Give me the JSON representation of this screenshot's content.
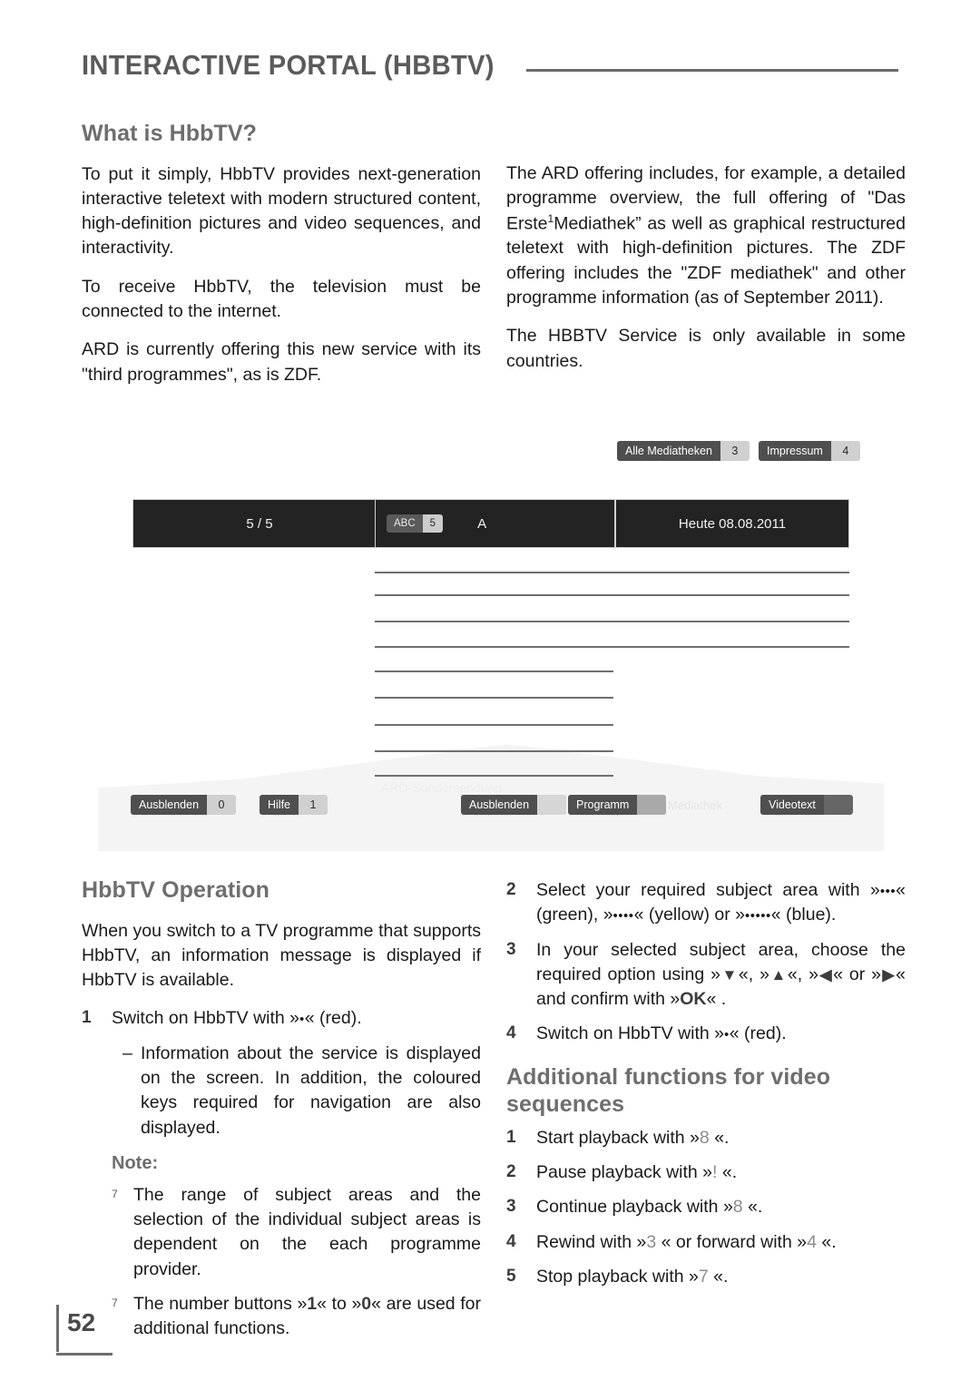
{
  "chapter": {
    "title": "INTERACTIVE PORTAL (HBBTV)"
  },
  "sections": {
    "what_is": {
      "heading": "What is HbbTV?",
      "left_paragraphs": [
        "To put it simply, HbbTV provides next-generation interactive teletext with modern structured content, high-definition pictures and video sequences, and interactivity.",
        "To receive HbbTV, the television must be connected to the internet.",
        "ARD is currently offering this new service with its \"third programmes\", as is ZDF."
      ],
      "right_para_1_a": "The ARD offering includes, for example, a detailed programme overview, the full offering of \"Das Erste",
      "right_para_1_fn": "1",
      "right_para_1_b": "Mediathek” as well as graphical restructured teletext with high-definition pictures. The ZDF offering includes the \"ZDF mediathek\" and other programme information (as of September 2011).",
      "right_para_2": "The HBBTV Service is only available in some countries."
    },
    "operation": {
      "heading": "HbbTV Operation",
      "intro": "When you switch to a TV programme that supports HbbTV, an information message is displayed if HbbTV is available.",
      "step1_num": "1",
      "step1_a": "Switch on HbbTV with »",
      "step1_key": "•",
      "step1_b": "« (red).",
      "substep1_dash": "–",
      "substep1_text": "Information about the service is displayed on the screen. In addition, the coloured keys required for navigation are also displayed.",
      "note_label": "Note:",
      "note_bullets": [
        {
          "mark": "7",
          "text": "The range of subject areas and the selection of the individual subject areas is dependent on the each programme provider."
        }
      ],
      "note_bullet2": {
        "mark": "7",
        "a": "The number buttons »",
        "key1": "1",
        "b": "« to »",
        "key2": "0",
        "c": "« are used for additional functions."
      },
      "step2_num": "2",
      "step2_a": "Select your required subject area with »",
      "step2_key1": "•••",
      "step2_b": "« (green), »",
      "step2_key2": "••••",
      "step2_c": "« (yellow) or »",
      "step2_key3": "•••••",
      "step2_d": "« (blue).",
      "step3_num": "3",
      "step3_a": "In your selected subject area, choose the required option using »",
      "step3_k1": "▼",
      "step3_b": "«, »",
      "step3_k2": "▲",
      "step3_c": "«, »",
      "step3_k3": "◀",
      "step3_d": "« or »",
      "step3_k4": "▶",
      "step3_e": "« and confirm with »",
      "step3_k5": "OK",
      "step3_f": "« .",
      "step4_num": "4",
      "step4_a": "Switch on HbbTV with »",
      "step4_key": "•",
      "step4_b": "« (red)."
    },
    "additional": {
      "heading": "Additional functions for video sequences",
      "steps": [
        {
          "num": "1",
          "a": "Start playback with »",
          "key": "8",
          "b": "  «."
        },
        {
          "num": "2",
          "a": "Pause playback with »",
          "key": "!",
          "b": "  «."
        },
        {
          "num": "3",
          "a": "Continue playback with »",
          "key": "8",
          "b": "  «."
        },
        {
          "num": "4",
          "a": "Rewind with »",
          "key": "3",
          "b": "  « or forward with »",
          "key2": "4",
          "c": "  «."
        },
        {
          "num": "5",
          "a": "Stop playback with »",
          "key": "7",
          "b": " «."
        }
      ]
    }
  },
  "illustration": {
    "top_buttons": [
      {
        "label": "Alle Mediatheken",
        "value": "3"
      },
      {
        "label": "Impressum",
        "value": "4"
      }
    ],
    "bars": {
      "left_text": "5 / 5",
      "mid_pill_label": "ABC",
      "mid_pill_value": "5",
      "mid_letter": "A",
      "right_text": "Heute 08.08.2011"
    },
    "ghost_text": "ARD-Sondersendung",
    "bottom_buttons_left": [
      {
        "label": "Ausblenden",
        "value": "0"
      },
      {
        "label": "Hilfe",
        "value": "1"
      }
    ],
    "bottom_buttons_right": [
      {
        "label": "Ausblenden",
        "value": ""
      },
      {
        "label": "Programm",
        "value": ""
      },
      {
        "label": "Videotext",
        "value": ""
      }
    ],
    "ghost_button_label": "Mediathek"
  },
  "footer": {
    "page_number": "52"
  }
}
